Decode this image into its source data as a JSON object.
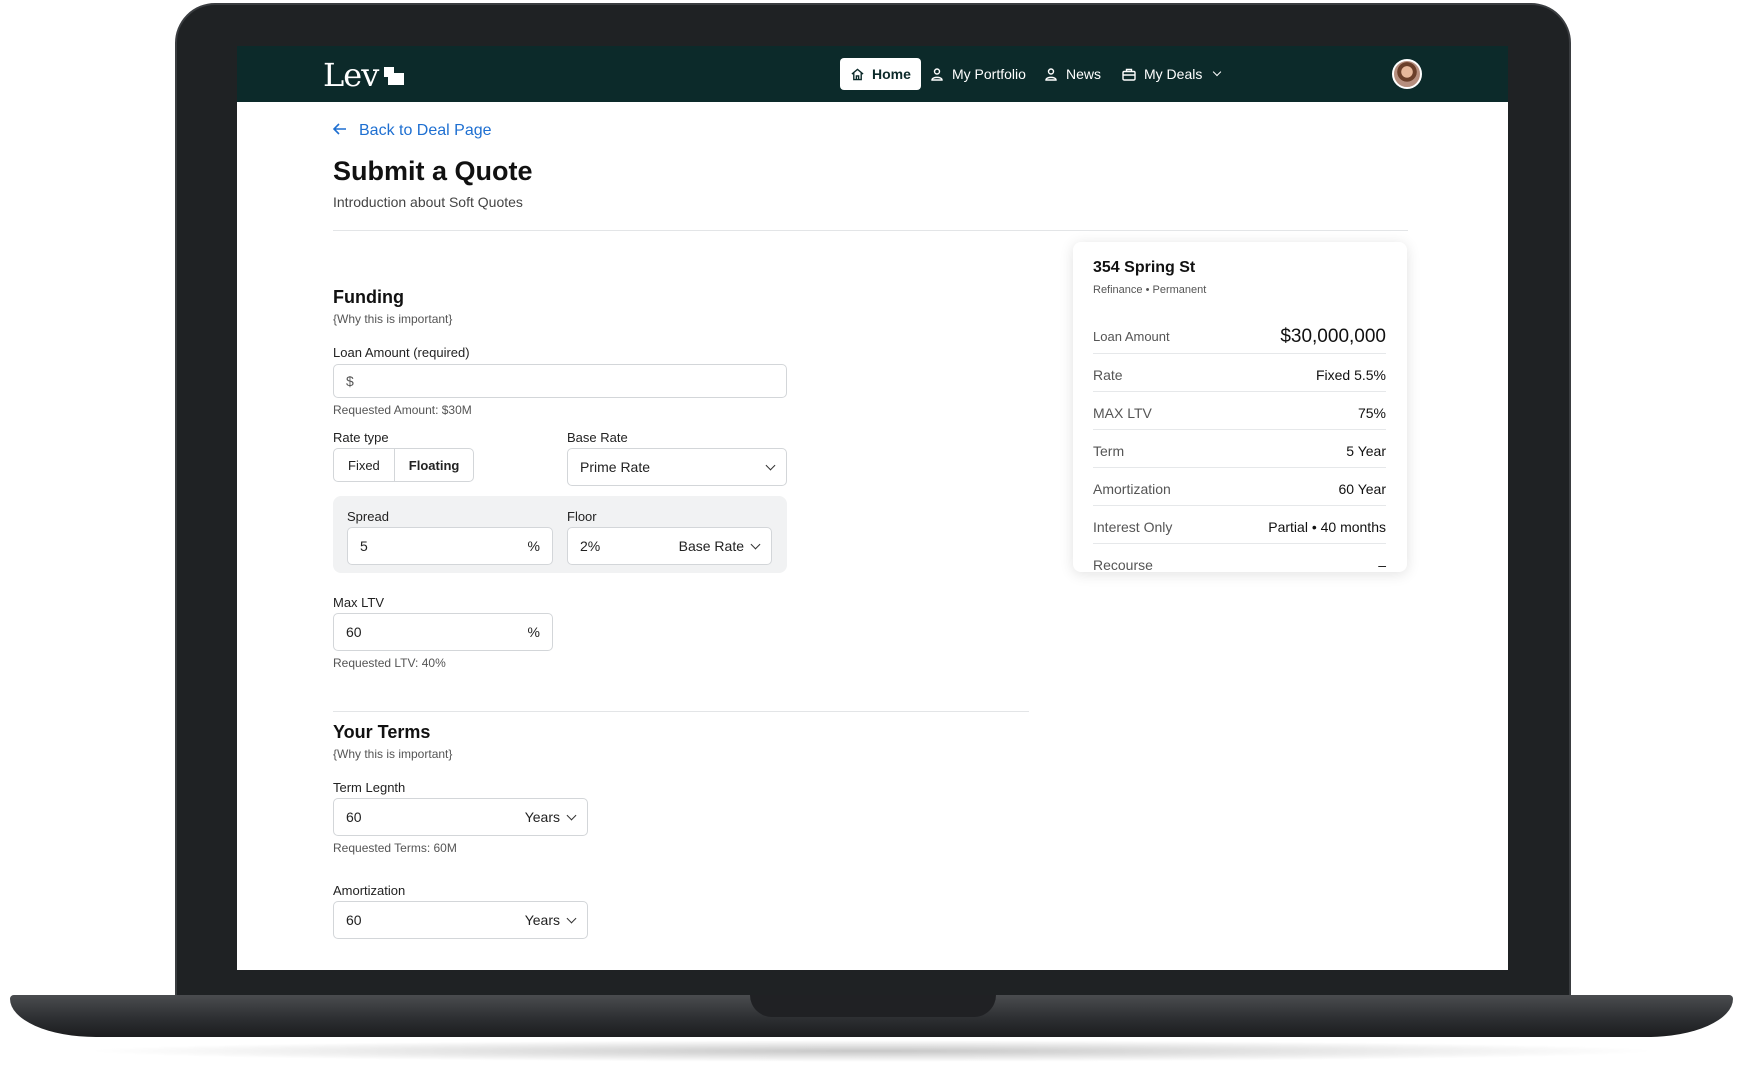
{
  "nav": {
    "logo_text": "Lev",
    "items": [
      {
        "label": "Home",
        "icon": "home-icon",
        "active": true
      },
      {
        "label": "My Portfolio",
        "icon": "user-icon"
      },
      {
        "label": "News",
        "icon": "user-icon"
      },
      {
        "label": "My Deals",
        "icon": "briefcase-icon"
      }
    ]
  },
  "page": {
    "back_link": "Back to Deal Page",
    "title": "Submit a Quote",
    "subtitle": "Introduction about Soft Quotes"
  },
  "funding": {
    "heading": "Funding",
    "hint": "{Why this is important}",
    "loan_label": "Loan Amount (required)",
    "loan_prefix": "$",
    "loan_helper": "Requested Amount: $30M",
    "rate_type_label": "Rate type",
    "rate_type_options": [
      "Fixed",
      "Floating"
    ],
    "rate_type_selected": "Floating",
    "base_rate_label": "Base Rate",
    "base_rate_value": "Prime Rate",
    "spread_label": "Spread",
    "spread_value": "5",
    "spread_unit": "%",
    "floor_label": "Floor",
    "floor_value": "2%",
    "floor_unit": "Base Rate",
    "max_ltv_label": "Max LTV",
    "max_ltv_value": "60",
    "max_ltv_unit": "%",
    "max_ltv_helper": "Requested LTV: 40%"
  },
  "terms": {
    "heading": "Your Terms",
    "hint": "{Why this is important}",
    "term_label": "Term Legnth",
    "term_value": "60",
    "term_unit": "Years",
    "term_helper": "Requested Terms: 60M",
    "amort_label": "Amortization",
    "amort_value": "60",
    "amort_unit": "Years"
  },
  "summary": {
    "title": "354 Spring St",
    "subtitle": "Refinance • Permanent",
    "rows": [
      {
        "label": "Loan Amount",
        "value": "$30,000,000"
      },
      {
        "label": "Rate",
        "value": "Fixed 5.5%"
      },
      {
        "label": "MAX LTV",
        "value": "75%"
      },
      {
        "label": "Term",
        "value": "5 Year"
      },
      {
        "label": "Amortization",
        "value": "60 Year"
      },
      {
        "label": "Interest Only",
        "value": "Partial • 40 months"
      },
      {
        "label": "Recourse",
        "value": "–"
      }
    ]
  },
  "colors": {
    "nav_bg": "#0c2a2a",
    "link": "#1e6fd1"
  }
}
